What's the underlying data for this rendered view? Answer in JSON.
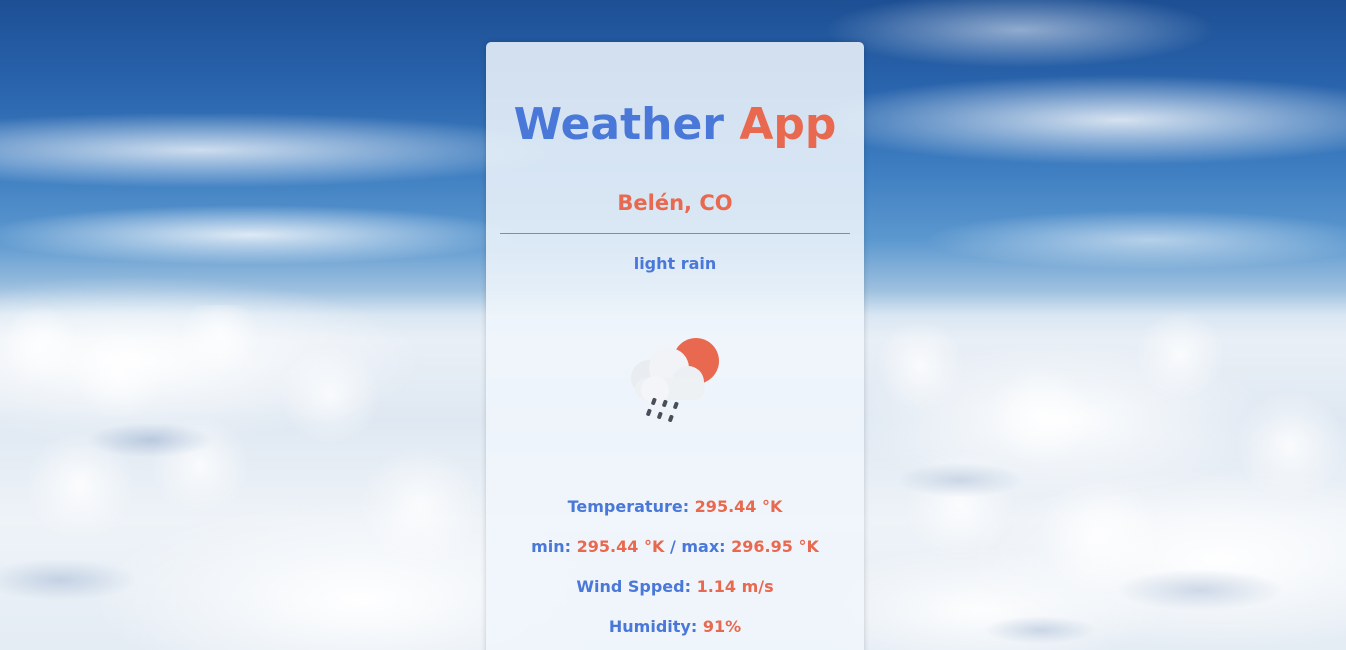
{
  "app": {
    "title_main": "Weather",
    "title_accent": "App"
  },
  "location": "Belén, CO",
  "weather": {
    "description": "light rain",
    "icon": "partly-sunny-rain-icon"
  },
  "stats": {
    "temperature_label": "Temperature:",
    "temperature_value": "295.44 °K",
    "min_label": "min:",
    "min_value": "295.44 °K",
    "separator": "/",
    "max_label": "max:",
    "max_value": "296.95 °K",
    "wind_label": "Wind Spped:",
    "wind_value": "1.14 m/s",
    "humidity_label": "Humidity:",
    "humidity_value": "91%"
  },
  "colors": {
    "primary": "#4a78d8",
    "accent": "#e8694f",
    "card_bg": "#f0f6fc"
  }
}
